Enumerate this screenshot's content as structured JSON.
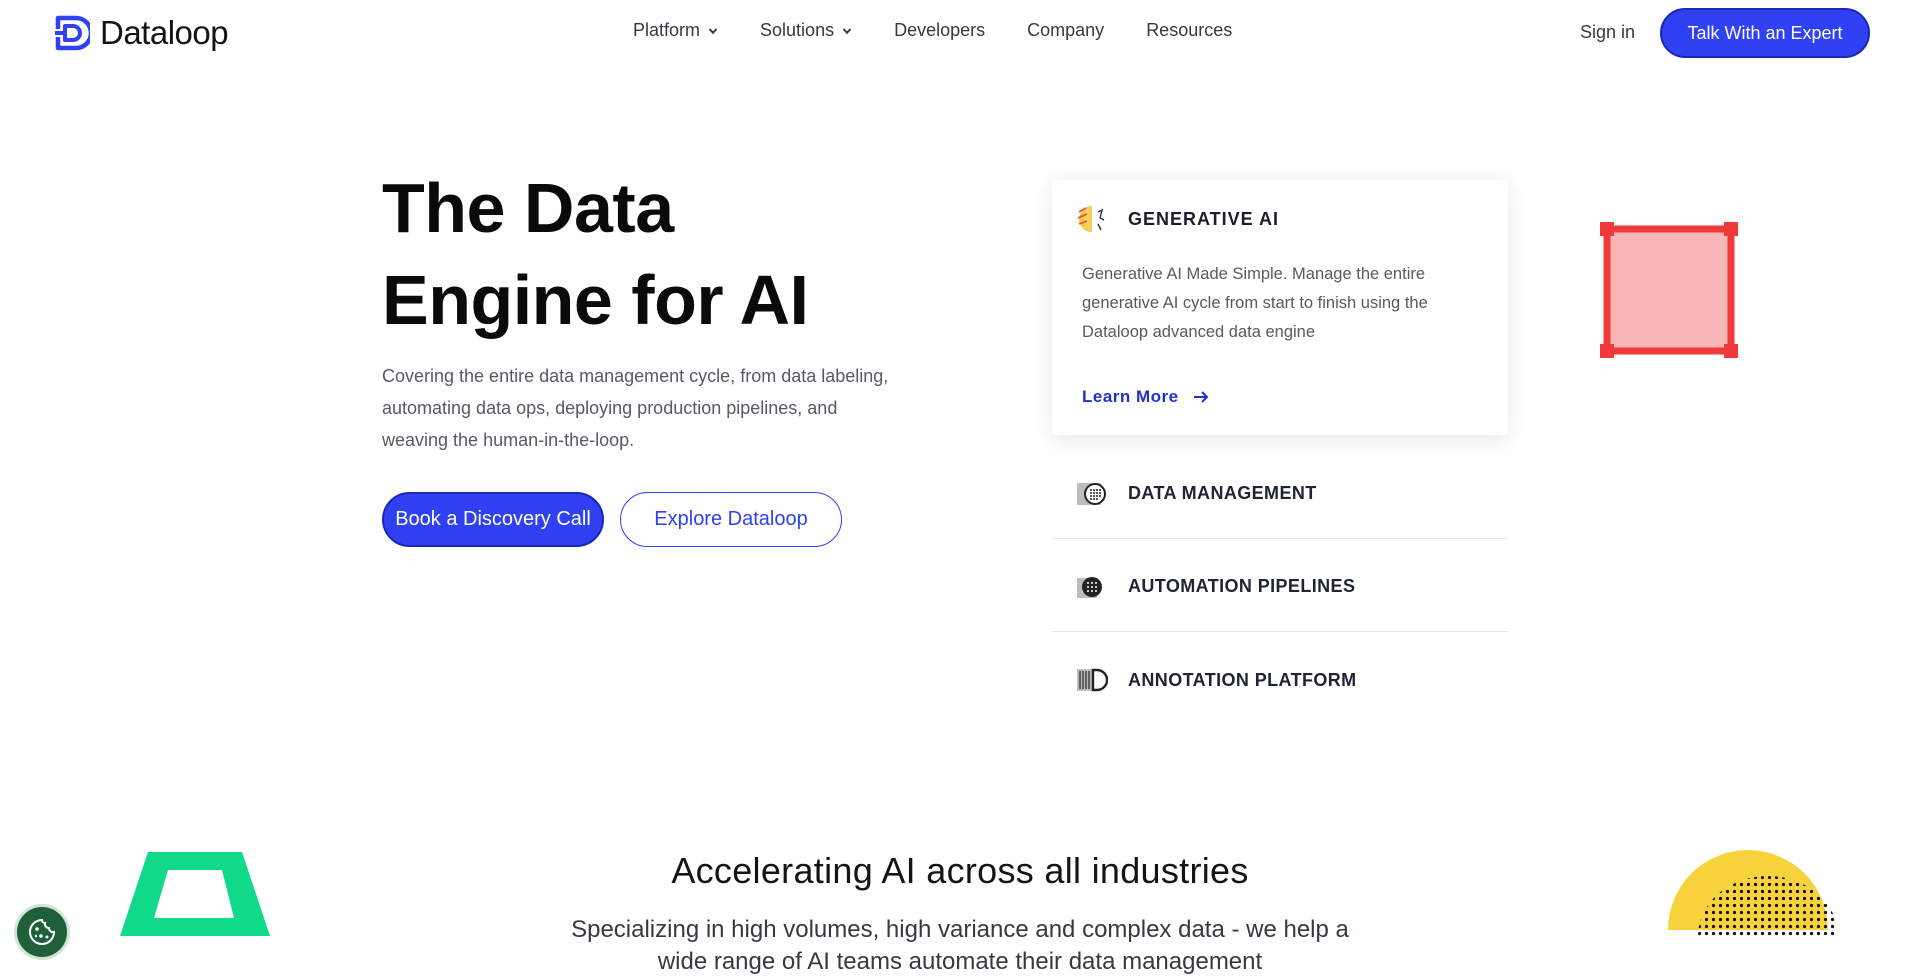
{
  "brand": {
    "name": "Dataloop",
    "accent": "#2f41f2"
  },
  "nav": {
    "items": [
      {
        "label": "Platform",
        "has_dropdown": true
      },
      {
        "label": "Solutions",
        "has_dropdown": true
      },
      {
        "label": "Developers",
        "has_dropdown": false
      },
      {
        "label": "Company",
        "has_dropdown": false
      },
      {
        "label": "Resources",
        "has_dropdown": false
      }
    ],
    "sign_in": "Sign in",
    "cta": "Talk With an Expert"
  },
  "hero": {
    "title_line1": "The Data",
    "title_line2": "Engine for AI",
    "subtitle": "Covering the entire data management cycle, from data labeling, automating data ops, deploying production pipelines, and weaving the human-in-the-loop.",
    "primary_button": "Book a Discovery Call",
    "secondary_button": "Explore Dataloop"
  },
  "features": {
    "active": {
      "title": "GENERATIVE AI",
      "icon": "generative-ai-icon",
      "description": "Generative AI Made Simple. Manage the entire generative AI cycle from start to finish using the Dataloop advanced data engine",
      "link": "Learn More"
    },
    "items": [
      {
        "title": "DATA MANAGEMENT",
        "icon": "data-management-icon"
      },
      {
        "title": "AUTOMATION PIPELINES",
        "icon": "automation-pipelines-icon"
      },
      {
        "title": "ANNOTATION PLATFORM",
        "icon": "annotation-platform-icon"
      }
    ]
  },
  "section": {
    "title": "Accelerating AI across all industries",
    "subtitle": "Specializing in high volumes, high variance and complex data - we help a wide range of AI teams automate their data management"
  },
  "decorations": {
    "square_color": "#f03a3a",
    "square_fill": "#f8b6b6",
    "trapezoid_color": "#10d98a",
    "semicircle_color": "#f7d23c"
  },
  "cookie_icon": "cookie-icon"
}
